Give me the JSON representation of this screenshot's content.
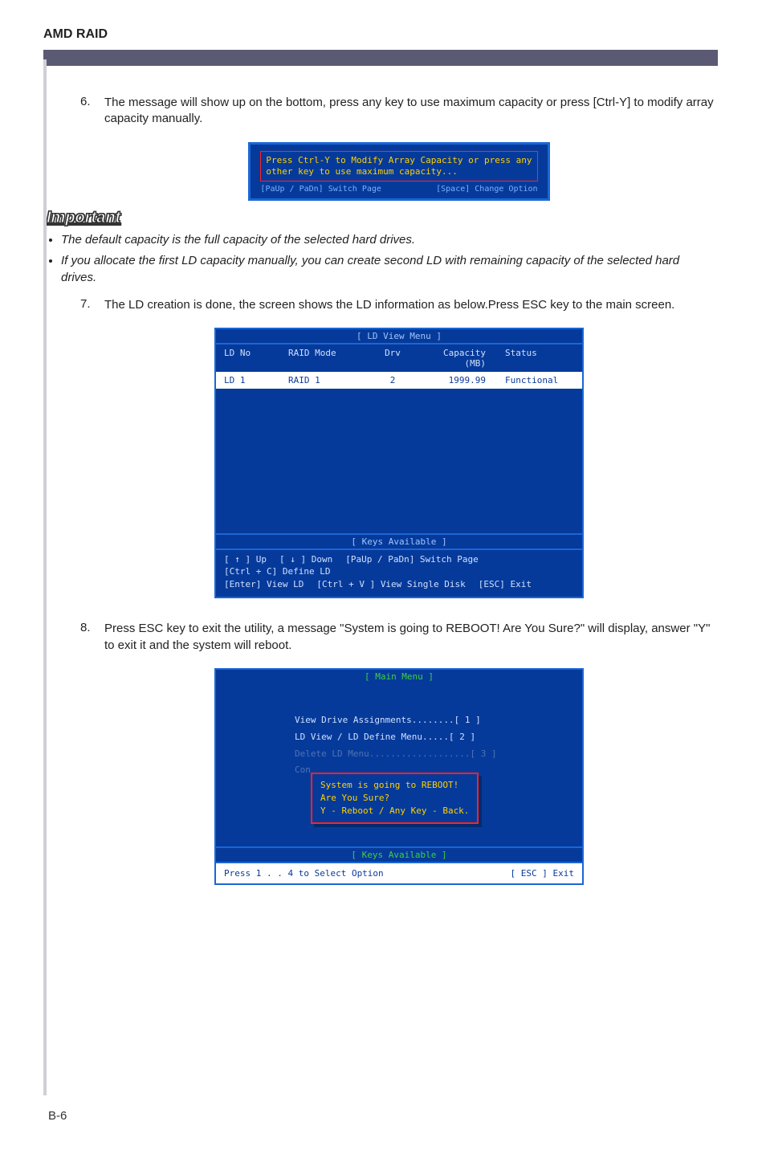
{
  "header": {
    "title": "AMD RAID"
  },
  "step6": {
    "num": "6.",
    "text": "The message will show up on the bottom, press any key to use maximum capacity or press [Ctrl-Y] to modify array capacity manually."
  },
  "shot1": {
    "line1": "Press Ctrl-Y to Modify Array Capacity or press any",
    "line2": "other key to use maximum capacity...",
    "footL": "[PaUp / PaDn] Switch Page",
    "footR": "[Space] Change Option"
  },
  "important": {
    "label": "Important",
    "b1": "The default capacity is the full capacity of the selected hard drives.",
    "b2": "If you allocate the first LD capacity manually, you can create second LD with remaining capacity of the selected hard drives."
  },
  "step7": {
    "num": "7.",
    "text": "The LD creation is done, the screen shows the LD information as below.Press ESC key to the main screen."
  },
  "shot2": {
    "title": "[ LD View Menu ]",
    "hdr": {
      "ldno": "LD No",
      "mode": "RAID Mode",
      "drv": "Drv",
      "cap": "Capacity (MB)",
      "stat": "Status"
    },
    "row": {
      "ldno": "LD   1",
      "mode": "RAID 1",
      "drv": "2",
      "cap": "1999.99",
      "stat": "Functional"
    },
    "keysTitle": "[ Keys Available ]",
    "k1": "[ ↑ ] Up",
    "k2": "[ ↓ ] Down",
    "k3": "[PaUp / PaDn] Switch Page",
    "k4": "[Ctrl + C] Define LD",
    "k5": "[Enter] View LD",
    "k6": "[Ctrl + V ] View Single Disk",
    "k7": "[ESC] Exit"
  },
  "step8": {
    "num": "8.",
    "text": "Press ESC key to exit the utility, a message \"System is going to REBOOT! Are You Sure?\" will display, answer \"Y\" to exit it and the system will reboot."
  },
  "shot3": {
    "title": "[ Main Menu ]",
    "m1": "View Drive Assignments........[  1  ]",
    "m2": "LD View / LD Define Menu.....[  2  ]",
    "m3": "Delete LD Menu...................[  3  ]",
    "m4prefix": "Con",
    "dlg1": "System is going to REBOOT!",
    "dlg2": "Are You Sure?",
    "dlg3": "Y - Reboot / Any Key - Back.",
    "keysTitle": "[ Keys Available ]",
    "footL": "Press 1 . . 4 to Select Option",
    "footR": "[ ESC ]   Exit"
  },
  "pageNumber": "B-6"
}
